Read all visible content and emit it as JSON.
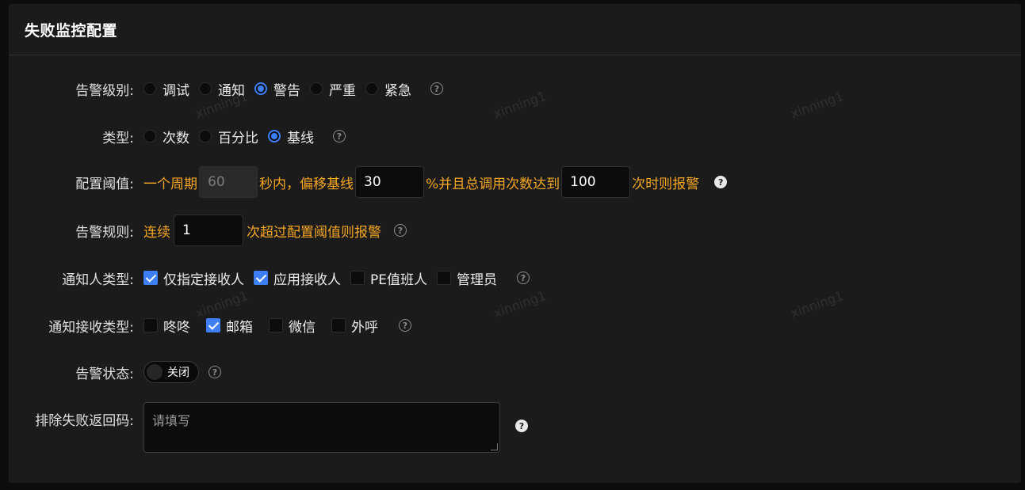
{
  "panel": {
    "title": "失败监控配置"
  },
  "watermark": "xinning1",
  "alert_level": {
    "label": "告警级别:",
    "options": [
      "调试",
      "通知",
      "警告",
      "严重",
      "紧急"
    ],
    "selected": "警告"
  },
  "type": {
    "label": "类型:",
    "options": [
      "次数",
      "百分比",
      "基线"
    ],
    "selected": "基线"
  },
  "threshold": {
    "label": "配置阈值:",
    "text_1": "一个周期",
    "period_value": "60",
    "text_2": "秒内，偏移基线",
    "offset_value": "30",
    "text_3": "%并且总调用次数达到",
    "count_value": "100",
    "text_4": "次时则报警"
  },
  "rule": {
    "label": "告警规则:",
    "text_1": "连续",
    "value": "1",
    "text_2": "次超过配置阈值则报警"
  },
  "notify_person": {
    "label": "通知人类型:",
    "options": [
      {
        "label": "仅指定接收人",
        "checked": true
      },
      {
        "label": "应用接收人",
        "checked": true
      },
      {
        "label": "PE值班人",
        "checked": false
      },
      {
        "label": "管理员",
        "checked": false
      }
    ]
  },
  "notify_channel": {
    "label": "通知接收类型:",
    "options": [
      {
        "label": "咚咚",
        "checked": false
      },
      {
        "label": "邮箱",
        "checked": true
      },
      {
        "label": "微信",
        "checked": false
      },
      {
        "label": "外呼",
        "checked": false
      }
    ]
  },
  "alert_status": {
    "label": "告警状态:",
    "toggle_text": "关闭",
    "on": false
  },
  "exclude_codes": {
    "label": "排除失败返回码:",
    "placeholder": "请填写"
  },
  "help_glyph": "?",
  "colors": {
    "accent": "#3d7ff7",
    "orange": "#f5a623",
    "panel": "#1b1b1b"
  }
}
